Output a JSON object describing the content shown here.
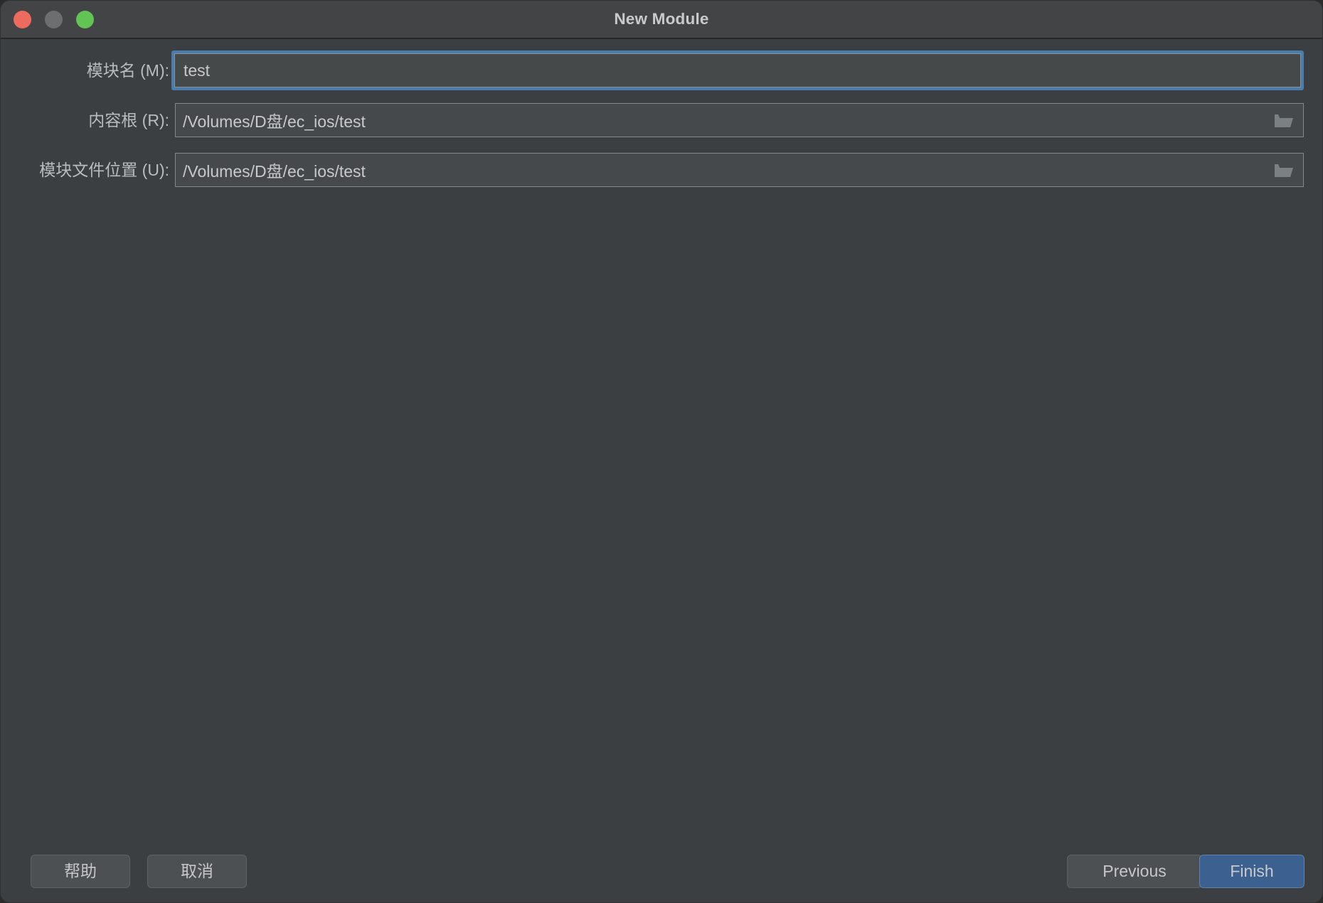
{
  "window": {
    "title": "New Module",
    "traffic_lights": [
      {
        "name": "close",
        "color": "#ec6b5e"
      },
      {
        "name": "minimize",
        "color": "#6d6e70"
      },
      {
        "name": "zoom",
        "color": "#61c454"
      }
    ]
  },
  "form": {
    "fields": [
      {
        "label": "模块名 (M):",
        "value": "test",
        "placeholder": "",
        "type": "text",
        "focused": true,
        "has_browse": false
      },
      {
        "label": "内容根 (R):",
        "value": "/Volumes/D盘/ec_ios/test",
        "placeholder": "",
        "type": "path",
        "focused": false,
        "has_browse": true,
        "browse_icon": "folder-icon"
      },
      {
        "label": "模块文件位置 (U):",
        "value": "/Volumes/D盘/ec_ios/test",
        "placeholder": "",
        "type": "path",
        "focused": false,
        "has_browse": true,
        "browse_icon": "folder-icon"
      }
    ]
  },
  "buttons": {
    "help": "帮助",
    "cancel": "取消",
    "previous": "Previous",
    "finish": "Finish"
  },
  "colors": {
    "window_background": "#3c3f41",
    "titlebar_background": "#434446",
    "input_background": "#45494a",
    "focus_ring": "#4b7cb0",
    "primary_button": "#3c6090",
    "text": "#c7c9ca"
  }
}
